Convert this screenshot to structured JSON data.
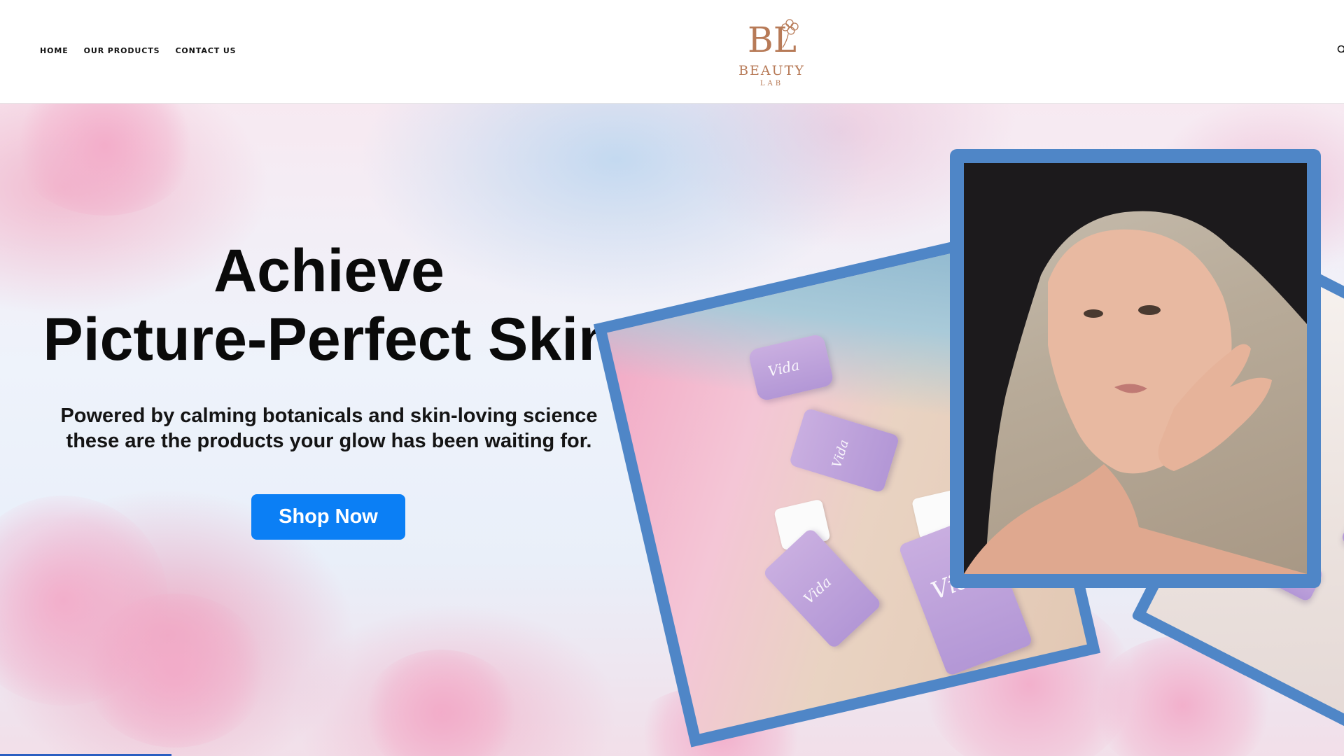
{
  "header": {
    "nav": [
      {
        "label": "HOME"
      },
      {
        "label": "OUR PRODUCTS"
      },
      {
        "label": "CONTACT US"
      }
    ],
    "logo": {
      "monogram": "BL",
      "wordmark": "BEAUTY",
      "sub": "LAB",
      "color": "#b77a57"
    }
  },
  "hero": {
    "title_line1": "Achieve",
    "title_line2": "Picture-Perfect Skin",
    "subtitle_line1": "Powered by calming botanicals and skin-loving science",
    "subtitle_line2": "these are the products your glow has been waiting for.",
    "cta_label": "Shop Now",
    "cta_color": "#0b7ff5",
    "frame_color": "#4f86c7",
    "product_label": "Vida"
  }
}
